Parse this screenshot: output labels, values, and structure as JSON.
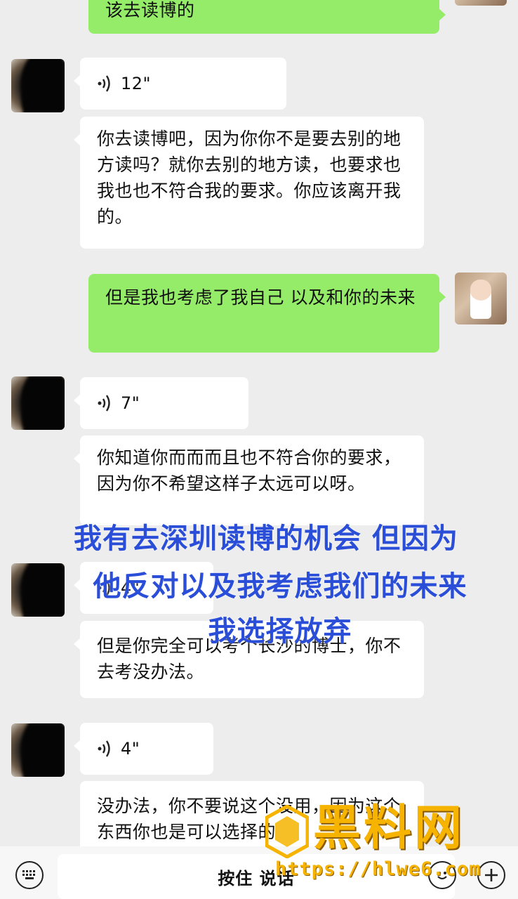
{
  "messages": {
    "m0_text": "该去读博的",
    "m1_duration": "12\"",
    "m2_text": "你去读博吧，因为你你不是要去别的地方读吗？就你去别的地方读，也要求也我也也不符合我的要求。你应该离开我的。",
    "m3_text": "但是我也考虑了我自己 以及和你的未来",
    "m4_duration": "7\"",
    "m5_text": "你知道你而而而且也不符合你的要求，因为你不希望这样子太远可以呀。",
    "m6_duration": "4\"",
    "m7_text": "但是你完全可以考个长沙的博士，你不去考没办法。",
    "m8_duration": "4\"",
    "m9_text": "没办法，你不要说这个没用，因为这个东西你也是可以选择的"
  },
  "overlay": {
    "line1": "我有去深圳读博的机会 但因为",
    "line2": "他反对以及我考虑我们的未来",
    "line3": "我选择放弃"
  },
  "input_bar": {
    "hold_to_talk": "按住 说话",
    "left_icon": "keyboard-icon",
    "emoji_icon": "emoji-icon",
    "plus_icon": "plus-icon"
  },
  "watermark": {
    "brand": "黑料网",
    "url": "https://hlwe6.com"
  },
  "colors": {
    "background": "#ededed",
    "incoming_bubble": "#ffffff",
    "outgoing_bubble": "#95ec69",
    "overlay_text": "#2a4ed8",
    "watermark": "#f6b400"
  }
}
